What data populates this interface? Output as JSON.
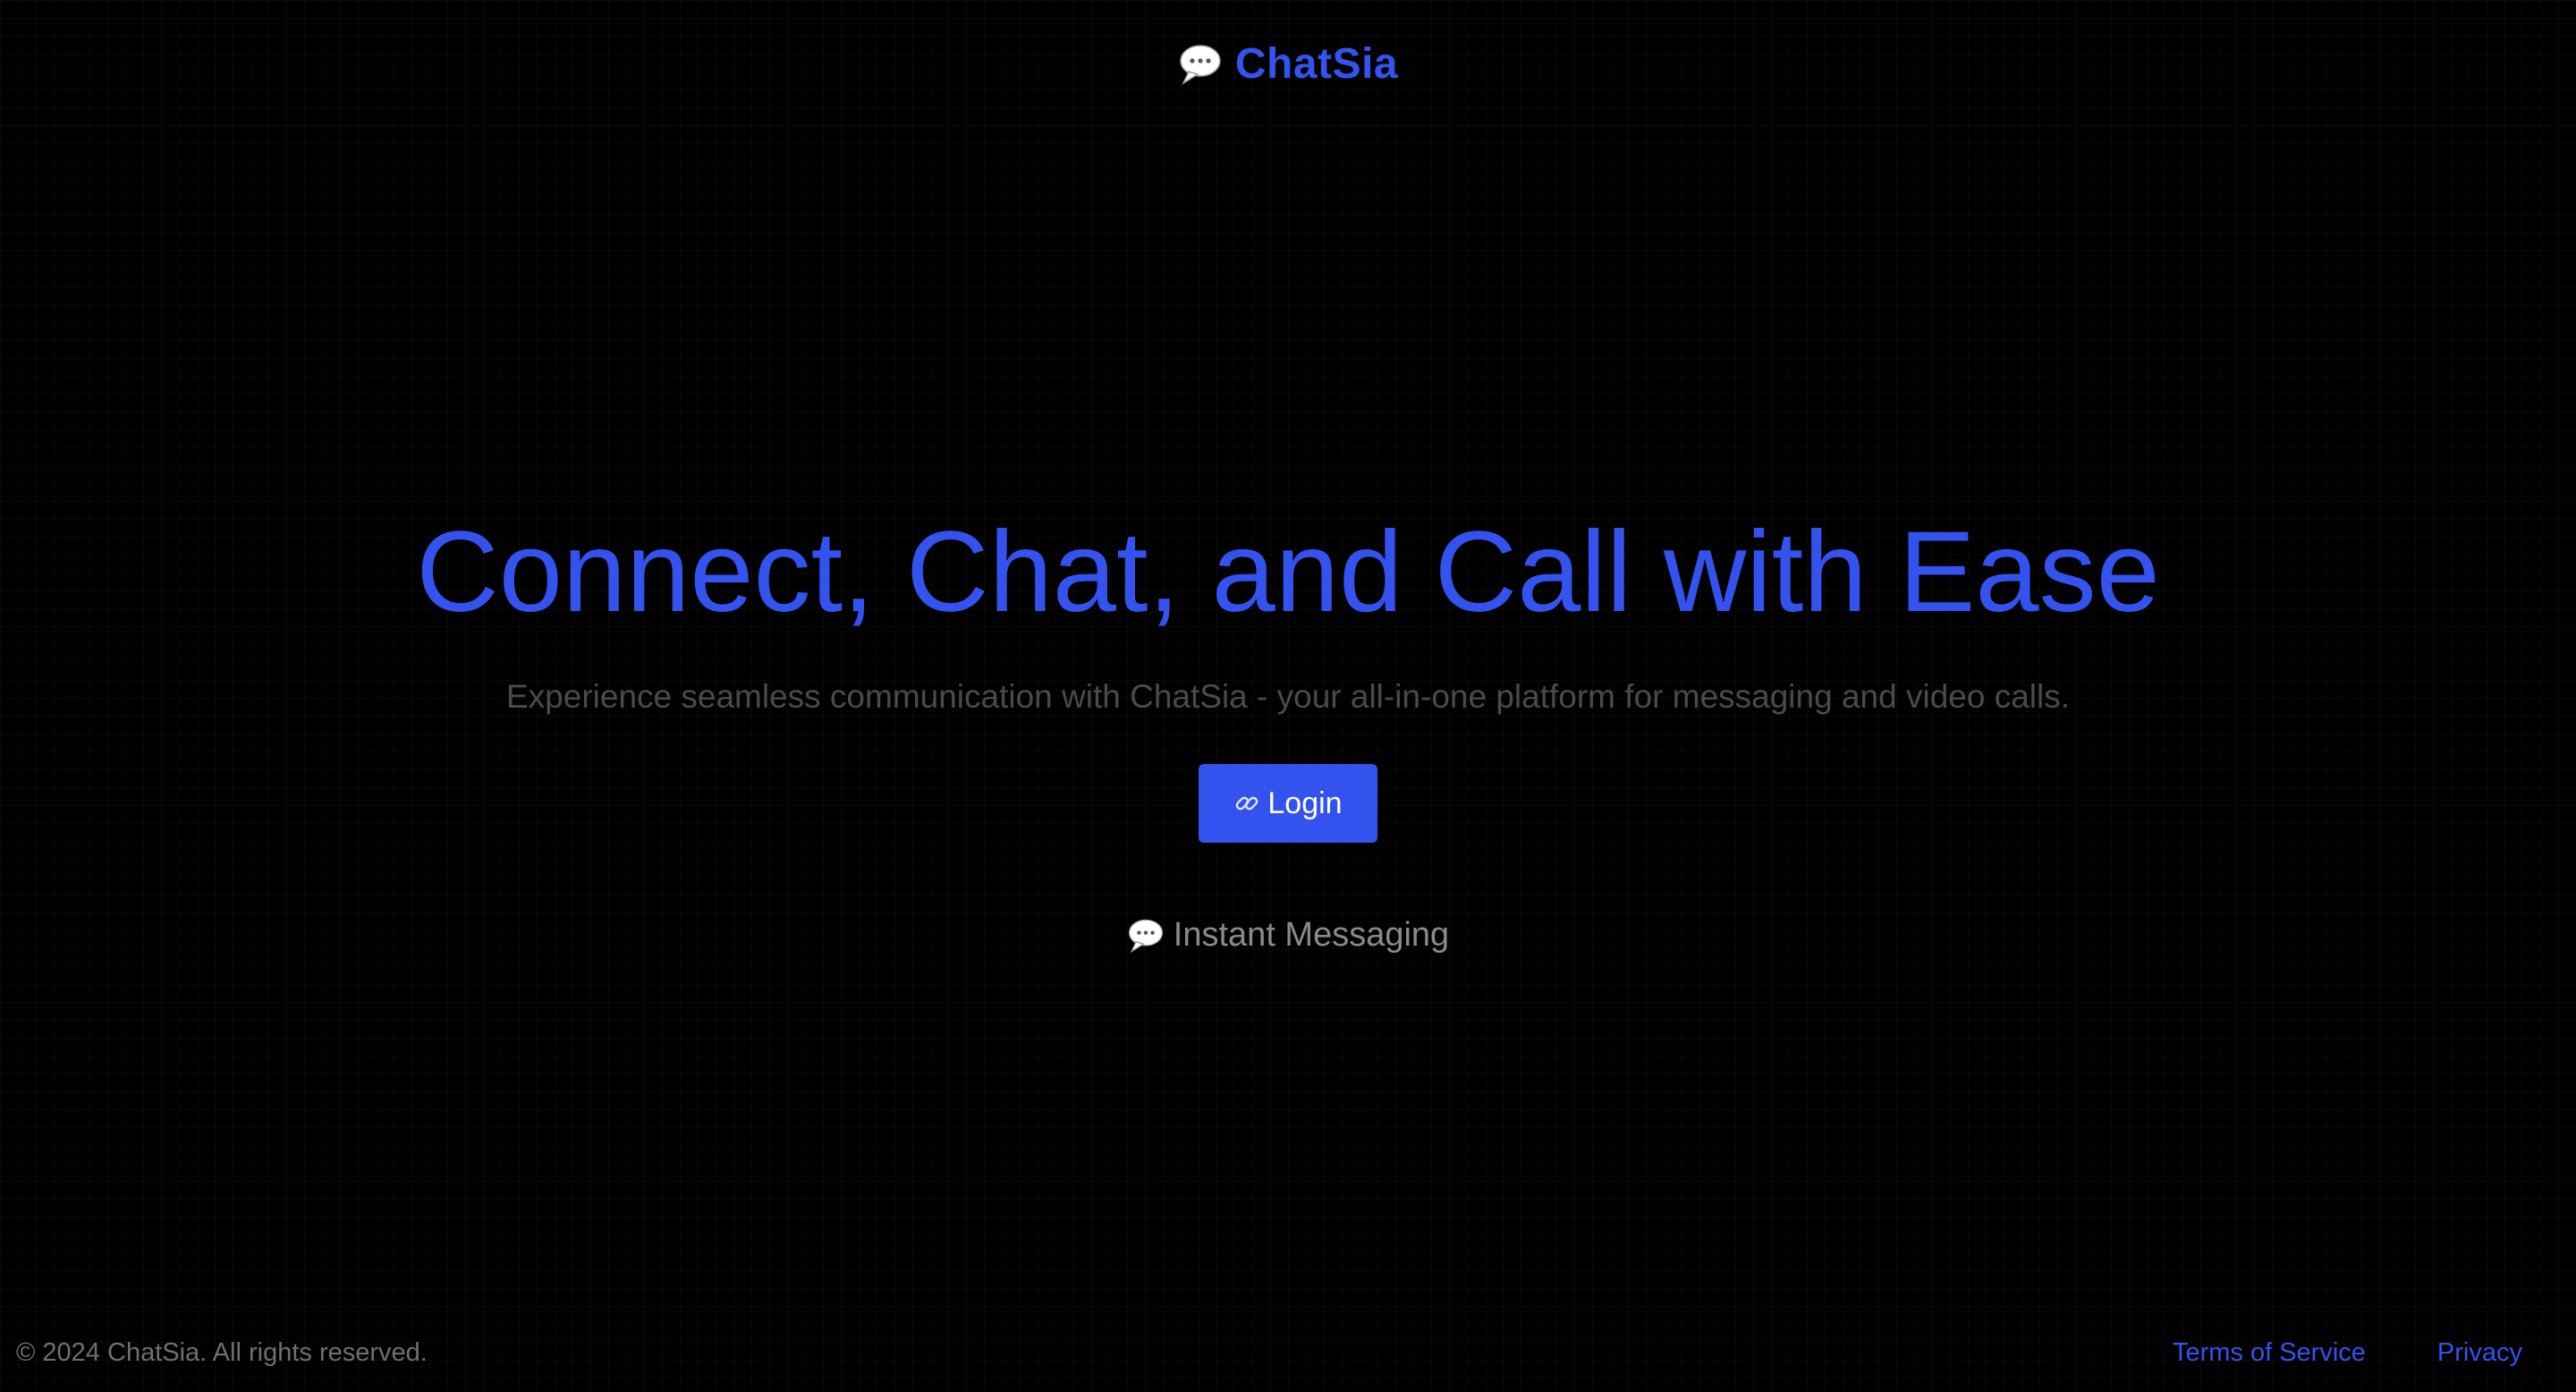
{
  "header": {
    "brand_icon": "speech-bubble-icon",
    "brand_name": "ChatSia"
  },
  "hero": {
    "title": "Connect, Chat, and Call with Ease",
    "subtitle": "Experience seamless communication with ChatSia - your all-in-one platform for messaging and video calls.",
    "login_icon": "link-icon",
    "login_label": "Login"
  },
  "features": [
    {
      "icon": "speech-bubble-icon",
      "label": "Instant Messaging"
    }
  ],
  "footer": {
    "copyright": "© 2024 ChatSia. All rights reserved.",
    "links": [
      "Terms of Service",
      "Privacy"
    ]
  },
  "colors": {
    "background": "#000000",
    "accent": "#3452ee",
    "subtitle_text": "#4a4a4a",
    "muted_text": "#8a8a8a"
  }
}
